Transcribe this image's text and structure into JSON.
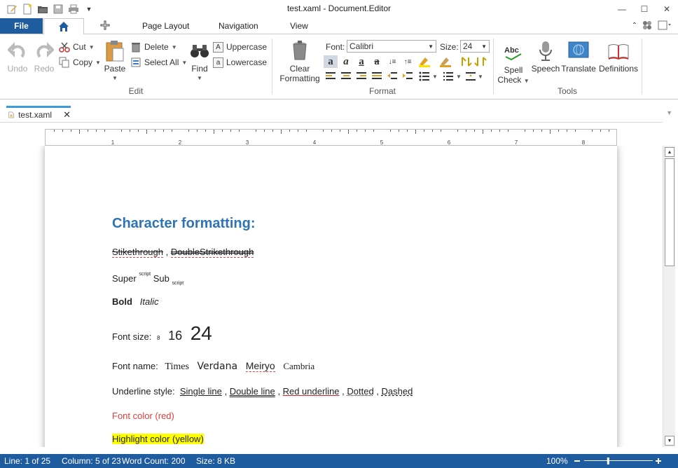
{
  "window": {
    "title": "test.xaml - Document.Editor",
    "minimize": "—",
    "maximize": "☐",
    "close": "✕"
  },
  "tabs": {
    "file": "File",
    "page_layout": "Page Layout",
    "navigation": "Navigation",
    "view": "View"
  },
  "ribbon": {
    "edit": {
      "label": "Edit",
      "undo": "Undo",
      "redo": "Redo",
      "cut": "Cut",
      "copy": "Copy",
      "paste": "Paste",
      "delete": "Delete",
      "select_all": "Select All",
      "find": "Find",
      "uppercase": "Uppercase",
      "lowercase": "Lowercase"
    },
    "format": {
      "label": "Format",
      "clear_formatting_1": "Clear",
      "clear_formatting_2": "Formatting",
      "font_label": "Font:",
      "font_value": "Calibri",
      "size_label": "Size:",
      "size_value": "24"
    },
    "tools": {
      "label": "Tools",
      "spell_check_1": "Spell",
      "spell_check_2": "Check",
      "speech": "Speech",
      "translate": "Translate",
      "definitions": "Definitions"
    }
  },
  "document_tab": {
    "name": "test.xaml"
  },
  "ruler": {
    "numbers": [
      "1",
      "2",
      "3",
      "4",
      "5",
      "6",
      "7",
      "8"
    ]
  },
  "document": {
    "heading": "Character formatting:",
    "strike": "Stikethrough",
    "strike_sep": " , ",
    "double_strike": "DoubleStrikethrough",
    "super_base": "Super",
    "super_text": "script",
    "sub_base": "Sub",
    "sub_text": "script",
    "bold": "Bold",
    "italic": "Italic",
    "font_size_label": "Font size:",
    "size_8": "8",
    "size_16": "16",
    "size_24": "24",
    "font_name_label": "Font name:",
    "font_times": "Times",
    "font_verdana": "Verdana",
    "font_meiryo": "Meiryo",
    "font_cambria": "Cambria",
    "underline_label": "Underline style:",
    "ul_single": "Single line",
    "ul_double": "Double line",
    "ul_red": "Red underline",
    "ul_dotted": "Dotted",
    "ul_dashed": "Dashed",
    "comma": " , ",
    "font_color": "Font color (red)",
    "highlight": "Highlight color (yellow)"
  },
  "status": {
    "line": "Line: 1 of 25",
    "column": "Column: 5 of 23",
    "word_count": "Word Count: 200",
    "size": "Size: 8 KB",
    "zoom": "100%",
    "zoom_level": 0.35
  },
  "colors": {
    "accent": "#1f5b9f",
    "heading": "#2e74b5",
    "font_red": "#e03c3c",
    "highlight": "#ffff00",
    "tab_indicator": "#3b9ad9"
  }
}
